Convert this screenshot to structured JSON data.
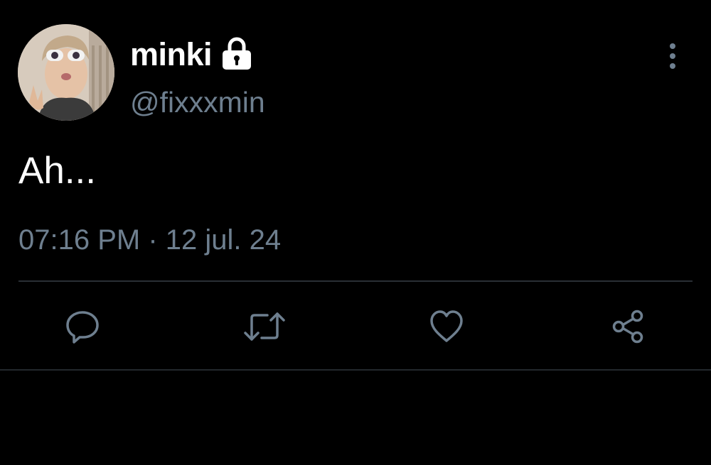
{
  "user": {
    "display_name": "minki",
    "handle": "@fixxxmin",
    "protected_icon": "lock-icon",
    "avatar_icon": "profile-photo"
  },
  "tweet": {
    "text": "Ah...",
    "time": "07:16 PM",
    "separator": "·",
    "date": "12 jul. 24"
  },
  "actions": [
    {
      "name": "reply",
      "icon": "speech-bubble-icon"
    },
    {
      "name": "retweet",
      "icon": "retweet-arrows-icon"
    },
    {
      "name": "like",
      "icon": "heart-icon"
    },
    {
      "name": "share",
      "icon": "share-nodes-icon"
    }
  ],
  "colors": {
    "background": "#000000",
    "primary_text": "#ffffff",
    "secondary_text": "#6e7f8f",
    "icon": "#6e7f8f",
    "divider": "#2a2f35"
  }
}
